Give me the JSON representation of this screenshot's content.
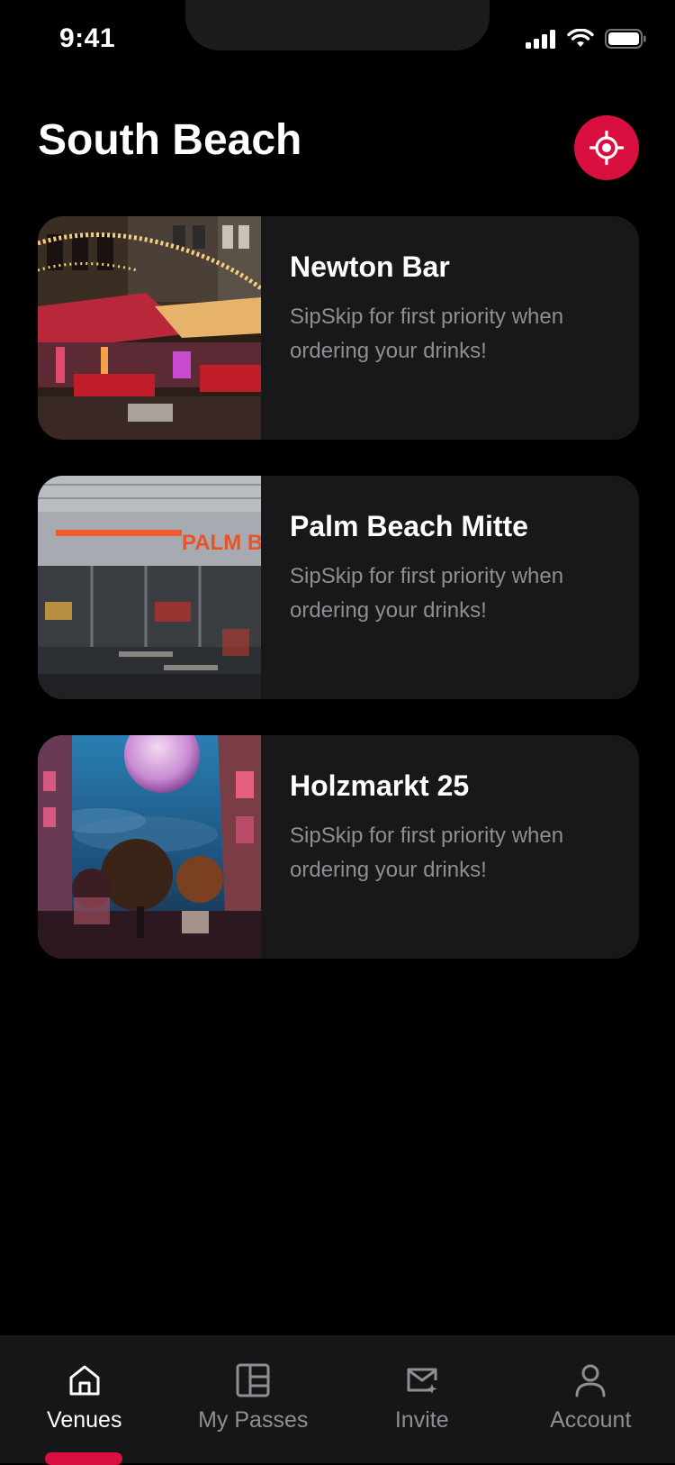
{
  "status_bar": {
    "time": "9:41"
  },
  "header": {
    "title": "South Beach",
    "locate_icon": "crosshair-icon"
  },
  "venues": [
    {
      "name": "Newton Bar",
      "description": "SipSkip for first priority when ordering your drinks!"
    },
    {
      "name": "Palm Beach Mitte",
      "description": "SipSkip for first priority when ordering your drinks!",
      "sign_text": "PALM BEACH"
    },
    {
      "name": "Holzmarkt 25",
      "description": "SipSkip for first priority when ordering your drinks!"
    }
  ],
  "tabs": [
    {
      "label": "Venues",
      "icon": "home-icon",
      "active": true
    },
    {
      "label": "My Passes",
      "icon": "passes-icon",
      "active": false
    },
    {
      "label": "Invite",
      "icon": "invite-mail-icon",
      "active": false
    },
    {
      "label": "Account",
      "icon": "user-icon",
      "active": false
    }
  ],
  "colors": {
    "accent": "#d90f3f",
    "card_background": "#18181b",
    "secondary_text": "#8e8e93",
    "tab_bar_background": "#161618"
  }
}
